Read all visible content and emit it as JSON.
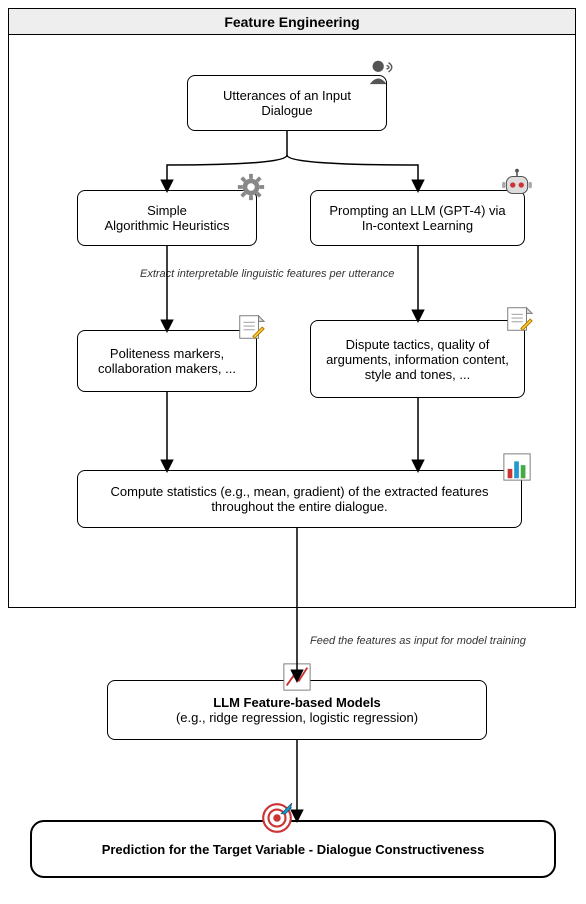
{
  "frame": {
    "title": "Feature Engineering"
  },
  "nodes": {
    "input": "Utterances of an Input Dialogue",
    "heur": "Simple\nAlgorithmic Heuristics",
    "llm": "Prompting an LLM (GPT-4) via In-context Learning",
    "polite": "Politeness markers, collaboration makers, ...",
    "dispute": "Dispute tactics, quality of arguments, information content, style and tones, ...",
    "stats": "Compute statistics (e.g., mean, gradient) of the extracted features throughout the entire dialogue.",
    "models_bold": "LLM Feature-based Models",
    "models_sub": "(e.g., ridge regression, logistic regression)",
    "pred": "Prediction for the Target Variable - Dialogue Constructiveness"
  },
  "edges": {
    "extract": "Extract interpretable linguistic features per utterance",
    "feed": "Feed the features as input for model training"
  },
  "icons": {
    "speaker": "speaker-icon",
    "gear": "gear-icon",
    "robot": "robot-icon",
    "note1": "note-icon",
    "note2": "note-icon",
    "barchart": "barchart-icon",
    "linechart": "linechart-icon",
    "target": "target-icon"
  }
}
